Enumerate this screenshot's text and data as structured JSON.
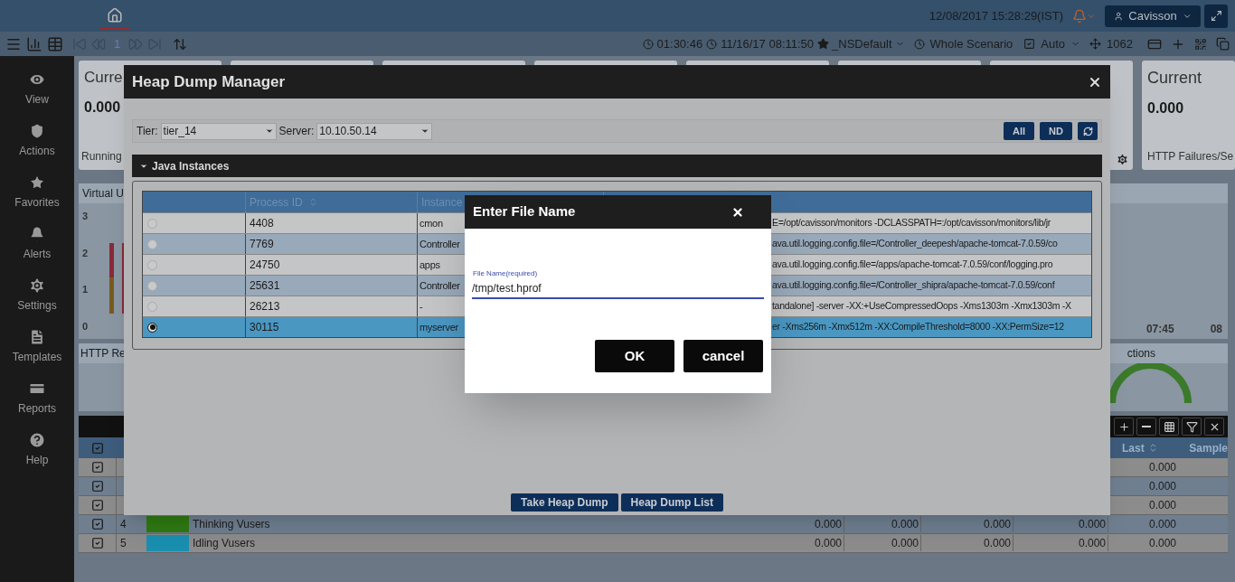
{
  "top_bar": {
    "datetime": "12/08/2017 15:28:29(IST)",
    "user": "Cavisson"
  },
  "toolbar": {
    "page": "1",
    "elapsed": "01:30:46",
    "start": "11/16/17 08:11:50",
    "favorite": "_NSDefault",
    "scenario": "Whole Scenario",
    "mode": "Auto",
    "count": "1062"
  },
  "sidebar": {
    "items": [
      {
        "label": "View"
      },
      {
        "label": "Actions"
      },
      {
        "label": "Favorites"
      },
      {
        "label": "Alerts"
      },
      {
        "label": "Settings"
      },
      {
        "label": "Templates"
      },
      {
        "label": "Reports"
      },
      {
        "label": "Help"
      }
    ]
  },
  "cards": [
    {
      "title": "Curre",
      "value": "0.000",
      "label": "Running"
    },
    {
      "title": "Current",
      "value": "0.000",
      "label": "HTTP Failures/Se"
    }
  ],
  "panels": {
    "virtual_users": {
      "title": "Virtual U",
      "y_ticks": [
        "3",
        "2",
        "1",
        "0"
      ]
    },
    "right_chart": {
      "x_ticks": [
        "07:45",
        "08"
      ]
    },
    "http_requests": {
      "title": "HTTP Re"
    },
    "connections": {
      "title": "ctions"
    }
  },
  "grid": {
    "header_checked": true,
    "columns": [
      "Last",
      "Sample"
    ],
    "rows": [
      {
        "checked": true,
        "last": "0.000"
      },
      {
        "checked": true,
        "last": "0.000"
      },
      {
        "checked": true,
        "last": "0.000"
      },
      {
        "checked": true,
        "index": "4",
        "color": "#2f7a12",
        "name": "Thinking Vusers",
        "values": [
          "0.000",
          "0.000",
          "0.000",
          "0.000"
        ],
        "last": "0.000"
      },
      {
        "checked": true,
        "index": "5",
        "color": "#1a8fb0",
        "name": "Idling Vusers",
        "values": [
          "0.000",
          "0.000",
          "0.000",
          "0.000"
        ],
        "last": "0.000"
      }
    ]
  },
  "heap_dump_manager": {
    "title": "Heap Dump Manager",
    "tier_label": "Tier:",
    "tier": "tier_14",
    "server_label": "Server:",
    "server": "10.10.50.14",
    "buttons": [
      "All",
      "ND"
    ],
    "section": {
      "title": "Java Instances",
      "expanded": true
    },
    "columns": [
      "Process ID",
      "Instance"
    ],
    "rows": [
      {
        "selected": false,
        "pid": "4408",
        "instance": "cmon",
        "args": "E=/opt/cavisson/monitors -DCLASSPATH=:/opt/cavisson/monitors/lib/jr"
      },
      {
        "selected": false,
        "pid": "7769",
        "instance": "Controller",
        "args": "ava.util.logging.config.file=/Controller_deepesh/apache-tomcat-7.0.59/co"
      },
      {
        "selected": false,
        "pid": "24750",
        "instance": "apps",
        "args": "ava.util.logging.config.file=/apps/apache-tomcat-7.0.59/conf/logging.pro"
      },
      {
        "selected": false,
        "pid": "25631",
        "instance": "Controller",
        "args": "ava.util.logging.config.file=/Controller_shipra/apache-tomcat-7.0.59/conf"
      },
      {
        "selected": false,
        "pid": "26213",
        "instance": "-",
        "args": "tandalone] -server -XX:+UseCompressedOops -Xms1303m -Xmx1303m -X"
      },
      {
        "selected": true,
        "pid": "30115",
        "instance": "myserver",
        "args": "er -Xms256m -Xmx512m -XX:CompileThreshold=8000 -XX:PermSize=12"
      }
    ],
    "actions": [
      "Take Heap Dump",
      "Heap Dump List"
    ]
  },
  "dialog": {
    "title": "Enter File Name",
    "field": {
      "label": "File Name(required)",
      "value": "/tmp/test.hprof"
    },
    "buttons": [
      "OK",
      "cancel"
    ]
  }
}
